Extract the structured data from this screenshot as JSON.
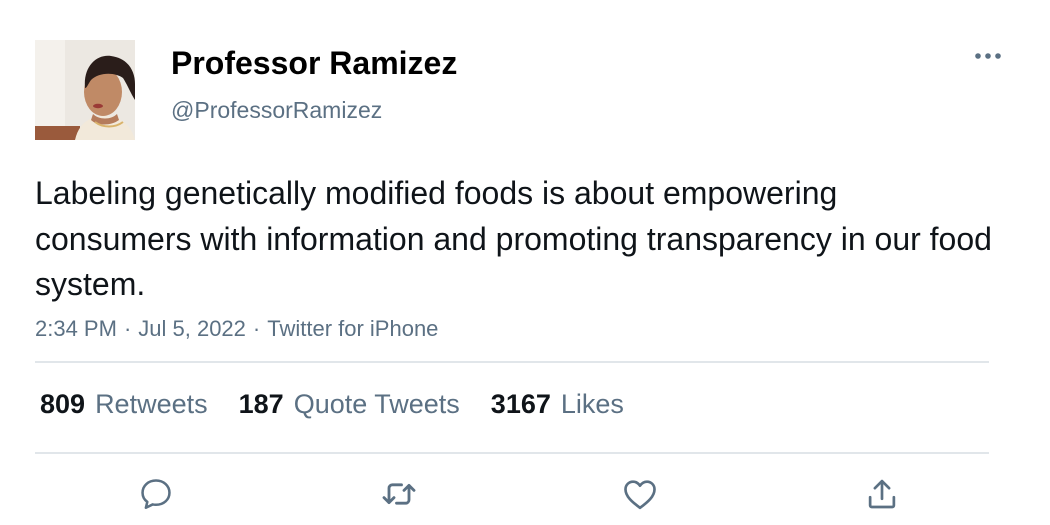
{
  "author": {
    "name": "Professor Ramizez",
    "handle": "@ProfessorRamizez"
  },
  "tweet": {
    "text": "Labeling genetically modified foods is about empowering consumers with information and promoting transparency in our food system.",
    "time": "2:34 PM",
    "date": "Jul 5, 2022",
    "source": "Twitter for iPhone",
    "separator": "·"
  },
  "stats": {
    "retweets_count": "809",
    "retweets_label": "Retweets",
    "quotes_count": "187",
    "quotes_label": "Quote Tweets",
    "likes_count": "3167",
    "likes_label": "Likes"
  },
  "icons": {
    "more": "more-horizontal-icon",
    "reply": "reply-icon",
    "retweet": "retweet-icon",
    "like": "heart-icon",
    "share": "share-icon"
  },
  "colors": {
    "text": "#0f1419",
    "secondary": "#5b7083",
    "divider": "#e1e6ea"
  }
}
